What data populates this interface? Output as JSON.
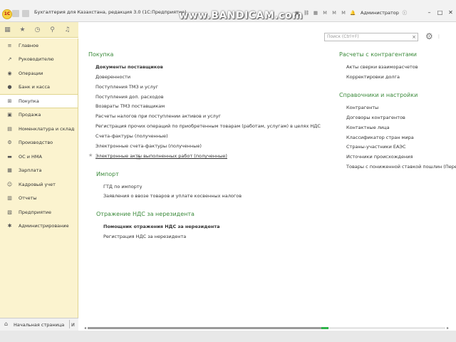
{
  "window": {
    "title": "Бухгалтерия для Казахстана, редакция 3.0  (1С:Предприятие)",
    "logo_text": "1С",
    "watermark": "www.BANDICAM.com",
    "user": "Администратор",
    "controls": [
      "–",
      "□",
      "✕"
    ]
  },
  "iconbar": [
    "grid-icon",
    "star-icon",
    "history-icon",
    "search-icon",
    "bell-icon"
  ],
  "sidebar": {
    "items": [
      {
        "label": "Главное",
        "icon": "≡"
      },
      {
        "label": "Руководителю",
        "icon": "↗"
      },
      {
        "label": "Операции",
        "icon": "◉"
      },
      {
        "label": "Банк и касса",
        "icon": "●"
      },
      {
        "label": "Покупка",
        "icon": "⊞",
        "active": true
      },
      {
        "label": "Продажа",
        "icon": "▣"
      },
      {
        "label": "Номенклатура и склад",
        "icon": "▤"
      },
      {
        "label": "Производство",
        "icon": "⚙"
      },
      {
        "label": "ОС и НМА",
        "icon": "▬"
      },
      {
        "label": "Зарплата",
        "icon": "▦"
      },
      {
        "label": "Кадровый учет",
        "icon": "☺"
      },
      {
        "label": "Отчеты",
        "icon": "▥"
      },
      {
        "label": "Предприятие",
        "icon": "▧"
      },
      {
        "label": "Администрирование",
        "icon": "✱"
      }
    ]
  },
  "search": {
    "placeholder": "Поиск (Ctrl+F)",
    "clear": "×"
  },
  "main": {
    "purchase": {
      "title": "Покупка",
      "links": [
        "Документы поставщиков",
        "Доверенности",
        "Поступления ТМЗ и услуг",
        "Поступления доп. расходов",
        "Возвраты ТМЗ поставщикам",
        "Расчеты налогов при поступлении активов и услуг",
        "Регистрация прочих операций по приобретенным товарам (работам, услугам) в целях НДС",
        "Счета-фактуры (полученные)",
        "Электронные счета-фактуры (полученные)",
        "Электронные акты выполненных работ (полученные)"
      ]
    },
    "import": {
      "title": "Импорт",
      "links": [
        "ГТД по импорту",
        "Заявления о ввозе товаров и уплате косвенных налогов"
      ]
    },
    "vat": {
      "title": "Отражение НДС за нерезидента",
      "links": [
        "Помощник отражения НДС за нерезидента",
        "Регистрация НДС за нерезидента"
      ]
    },
    "settlements": {
      "title": "Расчеты с контрагентами",
      "links": [
        "Акты сверки взаиморасчетов",
        "Корректировки долга"
      ]
    },
    "reference": {
      "title": "Справочники и настройки",
      "links": [
        "Контрагенты",
        "Договоры контрагентов",
        "Контактные лица",
        "Классификатор стран мира",
        "Страны-участники ЕАЭС",
        "Источники происхождения",
        "Товары с пониженной ставкой пошлин (Пере"
      ]
    }
  },
  "bottom": {
    "home_label": "Начальная страница",
    "tab2": "И"
  }
}
